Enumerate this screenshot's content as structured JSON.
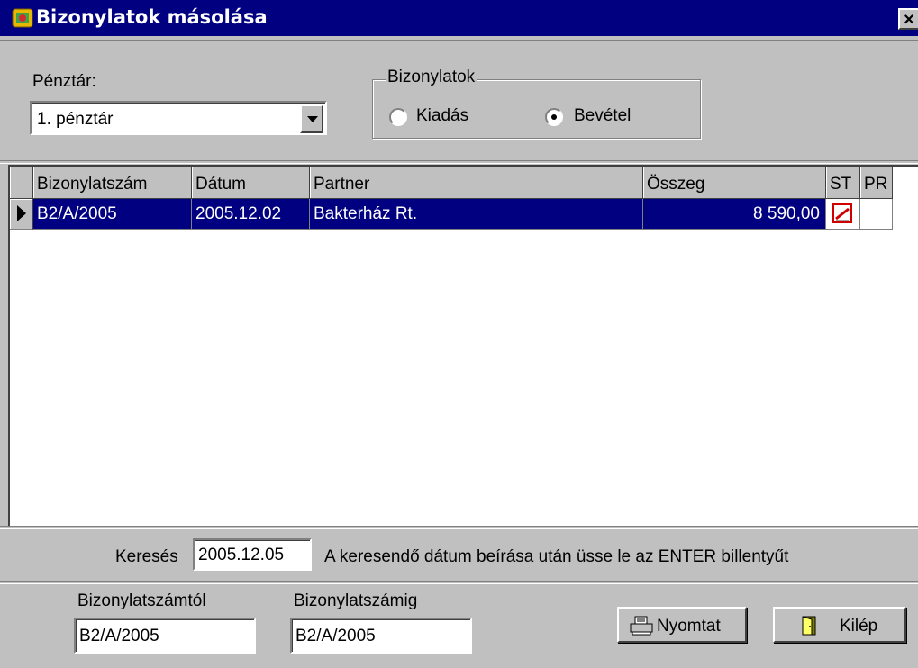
{
  "window": {
    "title": "Bizonylatok másolása",
    "close_label": "×"
  },
  "penztar": {
    "label": "Pénztár:",
    "value": "1. pénztár"
  },
  "bizonylatok": {
    "title": "Bizonylatok",
    "options": [
      {
        "label": "Kiadás",
        "selected": false
      },
      {
        "label": "Bevétel",
        "selected": true
      }
    ]
  },
  "grid": {
    "columns": [
      "Bizonylatszám",
      "Dátum",
      "Partner",
      "Összeg",
      "ST",
      "PR"
    ],
    "rows": [
      {
        "szam": "B2/A/2005",
        "datum": "2005.12.02",
        "partner": "Bakterház Rt.",
        "osszeg": "8 590,00",
        "st_icon": "status-icon",
        "pr": ""
      }
    ]
  },
  "search": {
    "label": "Keresés",
    "value": "2005.12.05",
    "hint": "A keresendő dátum beírása után üsse le az ENTER billentyűt"
  },
  "range": {
    "from_label": "Bizonylatszámtól",
    "from_value": "B2/A/2005",
    "to_label": "Bizonylatszámig",
    "to_value": "B2/A/2005"
  },
  "buttons": {
    "print_label": "Nyomtat",
    "exit_label": "Kilép"
  },
  "colors": {
    "titlebar": "#000080",
    "selection": "#000080",
    "face": "#c0c0c0"
  }
}
